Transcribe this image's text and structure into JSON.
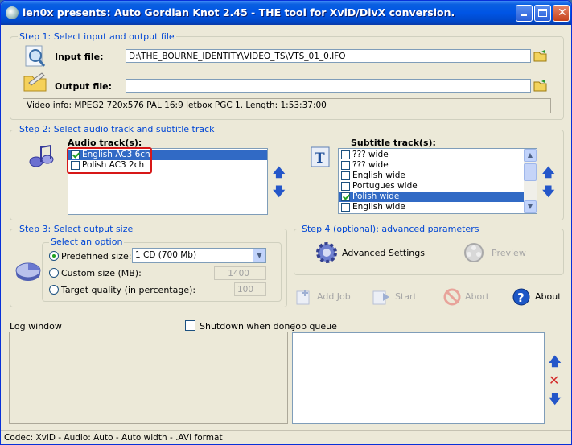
{
  "window": {
    "title": "len0x presents: Auto Gordian Knot 2.45 - THE tool for XviD/DivX conversion."
  },
  "step1": {
    "label": "Step 1: Select input and output file",
    "input_label": "Input file:",
    "input_value": "D:\\THE_BOURNE_IDENTITY\\VIDEO_TS\\VTS_01_0.IFO",
    "output_label": "Output file:",
    "output_value": "",
    "video_info": "Video info: MPEG2 720x576 PAL 16:9 letbox  PGC 1. Length: 1:53:37:00"
  },
  "step2": {
    "label": "Step 2: Select audio track and subtitle track",
    "audio_label": "Audio track(s):",
    "audio_tracks": [
      {
        "label": "English AC3 6ch",
        "checked": true
      },
      {
        "label": "Polish AC3 2ch",
        "checked": false
      }
    ],
    "subtitle_label": "Subtitle track(s):",
    "subtitle_tracks": [
      {
        "label": "??? wide",
        "checked": false
      },
      {
        "label": "??? wide",
        "checked": false
      },
      {
        "label": "English wide",
        "checked": false
      },
      {
        "label": "Portugues wide",
        "checked": false
      },
      {
        "label": "Polish wide",
        "checked": true
      },
      {
        "label": "English wide",
        "checked": false
      }
    ]
  },
  "step3": {
    "label": "Step 3: Select output size",
    "option_label": "Select an option",
    "predefined_label": "Predefined size:",
    "predefined_value": "1 CD (700 Mb)",
    "custom_label": "Custom size (MB):",
    "custom_value": "1400",
    "quality_label": "Target quality (in percentage):",
    "quality_value": "100"
  },
  "step4": {
    "label": "Step 4 (optional): advanced parameters",
    "advanced_label": "Advanced Settings",
    "preview_label": "Preview"
  },
  "actions": {
    "add_job": "Add Job",
    "start": "Start",
    "abort": "Abort",
    "about": "About"
  },
  "log": {
    "label": "Log window",
    "shutdown_label": "Shutdown when done"
  },
  "queue": {
    "label": "Job queue"
  },
  "status": "Codec: XviD -  Audio: Auto -  Auto width - .AVI format"
}
